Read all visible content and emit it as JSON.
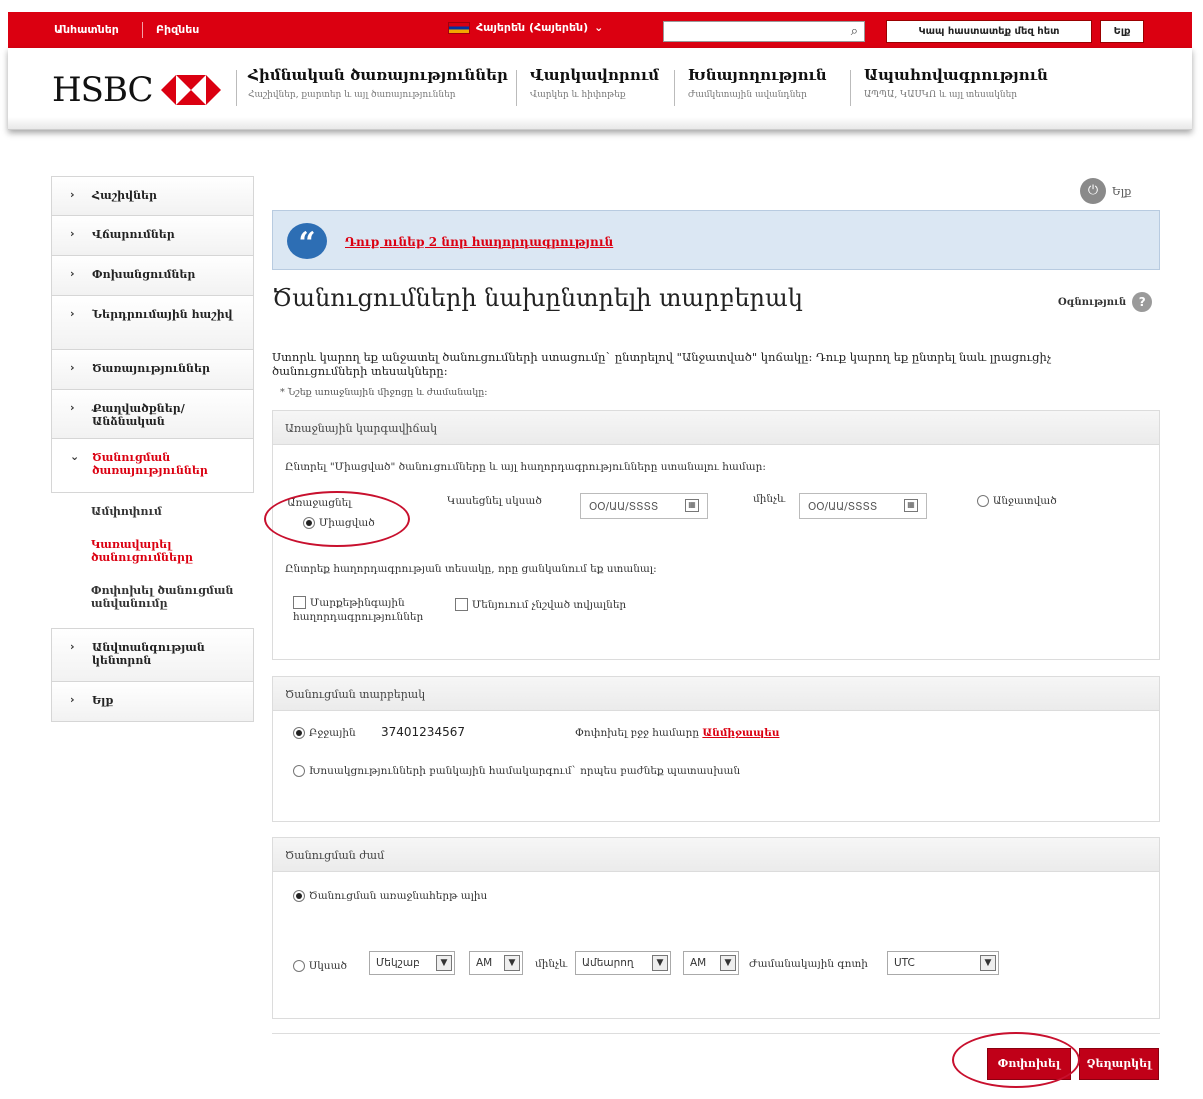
{
  "topbar": {
    "personal": "Անհատներ",
    "business": "Բիզնես",
    "language": "Հայերեն (Հայերեն)",
    "search_placeholder": "",
    "contact_button": "Կապ հաստատեք մեզ հետ",
    "logout_button": "Ելք"
  },
  "header": {
    "logo_text": "HSBC",
    "nav": [
      {
        "main": "Հիմնական ծառայություններ",
        "sub": "Հաշիվներ, քարտեր և այլ ծառայություններ"
      },
      {
        "main": "Վարկավորում",
        "sub": "Վարկեր և հիփոթեք"
      },
      {
        "main": "Խնայողություն",
        "sub": "Ժամկետային ավանդներ"
      },
      {
        "main": "Ապահովագրություն",
        "sub": "ԱՊՊԱ, ԿԱՍԿՈ և այլ տեսակներ"
      }
    ]
  },
  "sidebar": {
    "items": [
      {
        "label": "Հաշիվներ"
      },
      {
        "label": "Վճարումներ"
      },
      {
        "label": "Փոխանցումներ"
      },
      {
        "label": "Ներդրումային հաշիվ"
      },
      {
        "label": "Ծառայություններ"
      },
      {
        "label": "Քաղվածքներ/Անձնական"
      },
      {
        "label": "Ծանուցման ծառայություններ"
      },
      {
        "label": "Անվտանգության կենտրոն"
      },
      {
        "label": "Ելք"
      }
    ],
    "subitems": [
      {
        "label": "Ամփոփում"
      },
      {
        "label": "Կառավարել ծանուցումները"
      },
      {
        "label": "Փոփոխել ծանուցման անվանումը"
      }
    ]
  },
  "main": {
    "logout_label": "Ելք",
    "message_link": "Դուք ունեք 2 նոր հաղորդագրություն",
    "page_title": "Ծանուցումների նախընտրելի տարբերակ",
    "help_label": "Օգնություն",
    "intro_text": "Ստորև կարող եք անջատել ծանուցումների ստացումը` ընտրելով \"Անջատված\" կոճակը: Դուք կարող եք ընտրել նաև լրացուցիչ ծանուցումների տեսակները:",
    "required_note": "* Նշեք առաջնային միջոցը և ժամանակը:",
    "panel1": {
      "title": "Առաջնային կարգավիճակ",
      "instruction": "Ընտրել \"Միացված\" ծանուցումները և այլ հաղորդագրությունները ստանալու համար:",
      "receive_label": "Առաջացնել",
      "on_label": "Միացված",
      "start_label": "Կասեցնել սկսած",
      "until_label": "մինչև",
      "date_placeholder": "ՕՕ/ԱԱ/ՏՏՏՏ",
      "off_label": "Անջատված",
      "type_instruction": "Ընտրեք հաղորդագրության տեսակը, որը ցանկանում եք ստանալ:",
      "check1": "Մարքեթինգային հաղորդագրություններ",
      "check2": "Մենյուում չնշված տվյալներ"
    },
    "panel2": {
      "title": "Ծանուցման տարբերակ",
      "phone_label": "Բջջային",
      "phone_value": "37401234567",
      "change_label": "Փոփոխել բջջ համարը",
      "change_link": "Անմիջապես",
      "alt_label": "Խոսակցությունների բանկային համակարգում` որպես բաժնեք պատասխան"
    },
    "panel3": {
      "title": "Ծանուցման ժամ",
      "anytime_label": "Ծանուցման առաջնահերթ ալիս",
      "from_label": "Սկսած",
      "from_day": "Մեկշաբ",
      "from_ampm": "AM",
      "to_label": "մինչև",
      "to_day": "Ամեարող",
      "to_ampm": "AM",
      "tz_label": "Ժամանակային գոտի",
      "tz_value": "UTC"
    },
    "buttons": {
      "change": "Փոփոխել",
      "cancel": "Չեղարկել"
    }
  },
  "colors": {
    "brand_red": "#db0011",
    "link_blue": "#2d6eb4"
  }
}
